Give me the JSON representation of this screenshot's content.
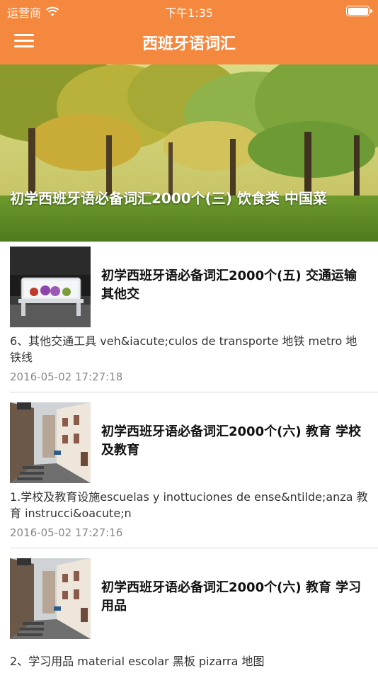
{
  "status_bar": {
    "carrier": "运营商",
    "time": "下午1:35"
  },
  "nav": {
    "title": "西班牙语词汇",
    "menu_icon": "hamburger-menu-icon"
  },
  "banner": {
    "caption": "初学西班牙语必备词汇2000个(三) 饮食类 中国菜"
  },
  "articles": [
    {
      "title": "初学西班牙语必备词汇2000个(五) 交通运输 其他交",
      "excerpt": "6、其他交通工具 veh&iacute;culos de transporte 地铁 metro 地铁线",
      "date": "2016-05-02 17:27:18"
    },
    {
      "title": "初学西班牙语必备词汇2000个(六) 教育 学校及教育",
      "excerpt": "1.学校及教育设施escuelas y inottuciones de ense&ntilde;anza 教育 instrucci&oacute;n",
      "date": "2016-05-02 17:27:16"
    },
    {
      "title": "初学西班牙语必备词汇2000个(六) 教育 学习用品",
      "excerpt": "2、学习用品 material escolar 黑板 pizarra 地图",
      "date": ""
    }
  ],
  "colors": {
    "accent": "#f5883f",
    "date_text": "#888888",
    "divider": "#d9d9d9"
  }
}
